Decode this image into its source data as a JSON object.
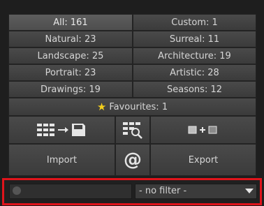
{
  "categories": [
    {
      "label": "All: 161",
      "selected": true
    },
    {
      "label": "Custom: 1"
    },
    {
      "label": "Natural: 23"
    },
    {
      "label": "Surreal: 11"
    },
    {
      "label": "Landscape: 25"
    },
    {
      "label": "Architecture: 19"
    },
    {
      "label": "Portrait: 23"
    },
    {
      "label": "Artistic: 28"
    },
    {
      "label": "Drawings: 19"
    },
    {
      "label": "Seasons: 12"
    }
  ],
  "favourites": {
    "label": "Favourites: 1",
    "icon": "star-icon"
  },
  "tools": {
    "grid_save_icon": "grid-to-save-icon",
    "grid_zoom_icon": "grid-zoom-icon",
    "merge_icon": "square-plus-square-icon"
  },
  "actions": {
    "import": "Import",
    "at_symbol": "@",
    "export": "Export"
  },
  "filter": {
    "search_placeholder": "",
    "select_value": "- no filter -"
  },
  "colors": {
    "highlight_border": "#e0141b",
    "star": "#f4cf1c"
  }
}
